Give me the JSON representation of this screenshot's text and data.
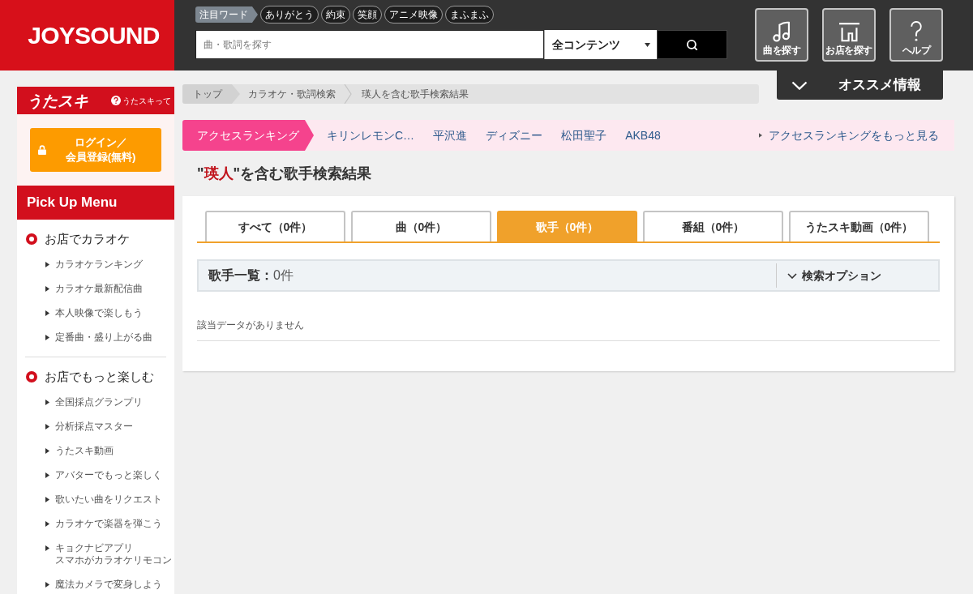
{
  "header": {
    "logo": "JOYSOUND",
    "trending_label": "注目ワード",
    "trending_words": [
      "ありがとう",
      "約束",
      "笑顔",
      "アニメ映像",
      "まふまふ"
    ],
    "search": {
      "placeholder": "曲・歌詞を探す",
      "category": "全コンテンツ"
    },
    "nav_buttons": [
      {
        "kind": "music",
        "label": "曲を探す"
      },
      {
        "kind": "store",
        "label": "お店を探す"
      },
      {
        "kind": "help",
        "label": "ヘルプ"
      }
    ],
    "recommend_tab": {
      "label": "オススメ情報",
      "expanded": false
    }
  },
  "sidebar": {
    "utasuki": {
      "title": "うたスキ",
      "help_link": "うたスキって",
      "login_button": {
        "lines": [
          "ログイン／",
          "会員登録(無料)"
        ]
      }
    },
    "pickup_title": "Pick Up Menu",
    "sections": [
      {
        "title": "お店でカラオケ",
        "items": [
          {
            "lines": [
              "カラオケランキング"
            ]
          },
          {
            "lines": [
              "カラオケ最新配信曲"
            ]
          },
          {
            "lines": [
              "本人映像で楽しもう"
            ]
          },
          {
            "lines": [
              "定番曲・盛り上がる曲"
            ]
          }
        ]
      },
      {
        "title": "お店でもっと楽しむ",
        "items": [
          {
            "lines": [
              "全国採点グランプリ"
            ]
          },
          {
            "lines": [
              "分析採点マスター"
            ]
          },
          {
            "lines": [
              "うたスキ動画"
            ]
          },
          {
            "lines": [
              "アバターでもっと楽しく"
            ]
          },
          {
            "lines": [
              "歌いたい曲をリクエスト"
            ]
          },
          {
            "lines": [
              "カラオケで楽器を弾こう"
            ]
          },
          {
            "lines": [
              "キョクナビアプリ",
              "スマホがカラオケリモコン"
            ]
          },
          {
            "lines": [
              "魔法カメラで変身しよう"
            ]
          }
        ]
      }
    ]
  },
  "breadcrumb": [
    "トップ",
    "カラオケ・歌詞検索",
    "瑛人を含む歌手検索結果"
  ],
  "ranking": {
    "label": "アクセスランキング",
    "items": [
      "キリンレモンC…",
      "平沢進",
      "ディズニー",
      "松田聖子",
      "AKB48"
    ],
    "more_link": "アクセスランキングをもっと見る"
  },
  "result_title": {
    "before": "\"",
    "query": "瑛人",
    "after": "\"を含む歌手検索結果"
  },
  "tabs": [
    {
      "label": "すべて（0件）",
      "selected": false
    },
    {
      "label": "曲（0件）",
      "selected": false
    },
    {
      "label": "歌手（0件）",
      "selected": true
    },
    {
      "label": "番組（0件）",
      "selected": false
    },
    {
      "label": "うたスキ動画（0件）",
      "selected": false
    }
  ],
  "list_header": {
    "label": "歌手一覧：",
    "count": "0件",
    "options_button": "検索オプション"
  },
  "empty_message": "該当データがありません"
}
